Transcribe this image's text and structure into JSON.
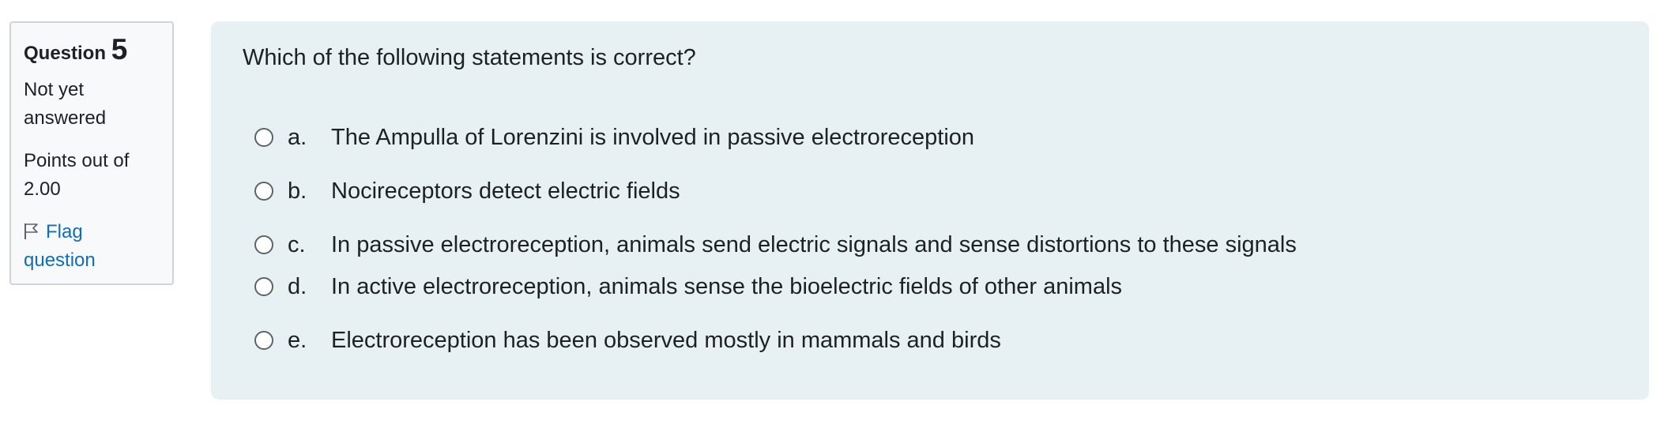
{
  "info": {
    "question_word": "Question",
    "question_number": "5",
    "state": "Not yet answered",
    "grade": "Points out of 2.00",
    "flag_label": "Flag question"
  },
  "question": {
    "text": "Which of the following statements is correct?",
    "options": [
      {
        "letter": "a.",
        "text": "The Ampulla of Lorenzini is involved in passive electroreception"
      },
      {
        "letter": "b.",
        "text": "Nocireceptors detect electric fields"
      },
      {
        "letter": "c.",
        "text": "In passive electroreception, animals send electric signals and sense distortions to these signals"
      },
      {
        "letter": "d.",
        "text": "In active electroreception, animals sense the bioelectric fields of other animals"
      },
      {
        "letter": "e.",
        "text": "Electroreception has been observed mostly in mammals and birds"
      }
    ]
  }
}
